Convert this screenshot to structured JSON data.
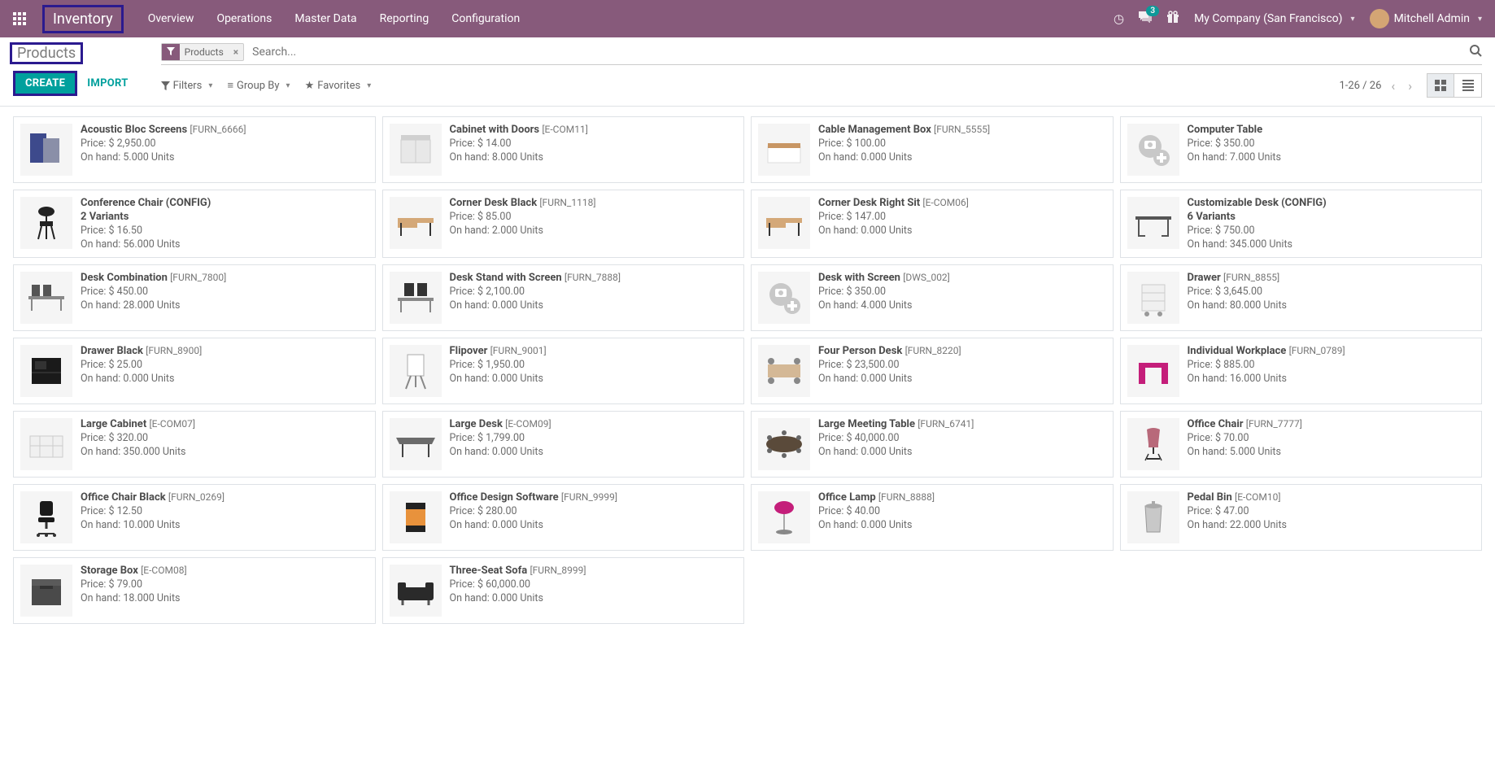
{
  "navbar": {
    "brand": "Inventory",
    "menu": [
      "Overview",
      "Operations",
      "Master Data",
      "Reporting",
      "Configuration"
    ],
    "chat_count": "3",
    "company": "My Company (San Francisco)",
    "user": "Mitchell Admin"
  },
  "breadcrumb": "Products",
  "buttons": {
    "create": "CREATE",
    "import": "IMPORT"
  },
  "search": {
    "facet_label": "Products",
    "placeholder": "Search...",
    "filters": "Filters",
    "groupby": "Group By",
    "favorites": "Favorites"
  },
  "pager": "1-26 / 26",
  "products": [
    {
      "name": "Acoustic Bloc Screens",
      "sku": "[FURN_6666]",
      "price": "Price: $ 2,950.00",
      "onhand": "On hand: 5.000 Units",
      "icon": "screens"
    },
    {
      "name": "Cabinet with Doors",
      "sku": "[E-COM11]",
      "price": "Price: $ 14.00",
      "onhand": "On hand: 8.000 Units",
      "icon": "cabinet"
    },
    {
      "name": "Cable Management Box",
      "sku": "[FURN_5555]",
      "price": "Price: $ 100.00",
      "onhand": "On hand: 0.000 Units",
      "icon": "box-wood"
    },
    {
      "name": "Computer Table",
      "sku": "",
      "price": "Price: $ 350.00",
      "onhand": "On hand: 7.000 Units",
      "icon": "noimg"
    },
    {
      "name": "Conference Chair (CONFIG)",
      "sku": "",
      "variants": "2 Variants",
      "price": "Price: $ 16.50",
      "onhand": "On hand: 56.000 Units",
      "icon": "chair-black"
    },
    {
      "name": "Corner Desk Black",
      "sku": "[FURN_1118]",
      "price": "Price: $ 85.00",
      "onhand": "On hand: 2.000 Units",
      "icon": "desk-corner"
    },
    {
      "name": "Corner Desk Right Sit",
      "sku": "[E-COM06]",
      "price": "Price: $ 147.00",
      "onhand": "On hand: 0.000 Units",
      "icon": "desk-corner"
    },
    {
      "name": "Customizable Desk (CONFIG)",
      "sku": "",
      "variants": "6 Variants",
      "price": "Price: $ 750.00",
      "onhand": "On hand: 345.000 Units",
      "icon": "desk-wire"
    },
    {
      "name": "Desk Combination",
      "sku": "[FURN_7800]",
      "price": "Price: $ 450.00",
      "onhand": "On hand: 28.000 Units",
      "icon": "desk-combo"
    },
    {
      "name": "Desk Stand with Screen",
      "sku": "[FURN_7888]",
      "price": "Price: $ 2,100.00",
      "onhand": "On hand: 0.000 Units",
      "icon": "desk-screen"
    },
    {
      "name": "Desk with Screen",
      "sku": "[DWS_002]",
      "price": "Price: $ 350.00",
      "onhand": "On hand: 4.000 Units",
      "icon": "noimg"
    },
    {
      "name": "Drawer",
      "sku": "[FURN_8855]",
      "price": "Price: $ 3,645.00",
      "onhand": "On hand: 80.000 Units",
      "icon": "drawer-white"
    },
    {
      "name": "Drawer Black",
      "sku": "[FURN_8900]",
      "price": "Price: $ 25.00",
      "onhand": "On hand: 0.000 Units",
      "icon": "drawer-black"
    },
    {
      "name": "Flipover",
      "sku": "[FURN_9001]",
      "price": "Price: $ 1,950.00",
      "onhand": "On hand: 0.000 Units",
      "icon": "flipover"
    },
    {
      "name": "Four Person Desk",
      "sku": "[FURN_8220]",
      "price": "Price: $ 23,500.00",
      "onhand": "On hand: 0.000 Units",
      "icon": "four-desk"
    },
    {
      "name": "Individual Workplace",
      "sku": "[FURN_0789]",
      "price": "Price: $ 885.00",
      "onhand": "On hand: 16.000 Units",
      "icon": "workplace-pink"
    },
    {
      "name": "Large Cabinet",
      "sku": "[E-COM07]",
      "price": "Price: $ 320.00",
      "onhand": "On hand: 350.000 Units",
      "icon": "cabinet-large"
    },
    {
      "name": "Large Desk",
      "sku": "[E-COM09]",
      "price": "Price: $ 1,799.00",
      "onhand": "On hand: 0.000 Units",
      "icon": "desk-large"
    },
    {
      "name": "Large Meeting Table",
      "sku": "[FURN_6741]",
      "price": "Price: $ 40,000.00",
      "onhand": "On hand: 0.000 Units",
      "icon": "meeting"
    },
    {
      "name": "Office Chair",
      "sku": "[FURN_7777]",
      "price": "Price: $ 70.00",
      "onhand": "On hand: 5.000 Units",
      "icon": "chair-pink"
    },
    {
      "name": "Office Chair Black",
      "sku": "[FURN_0269]",
      "price": "Price: $ 12.50",
      "onhand": "On hand: 10.000 Units",
      "icon": "office-chair"
    },
    {
      "name": "Office Design Software",
      "sku": "[FURN_9999]",
      "price": "Price: $ 280.00",
      "onhand": "On hand: 0.000 Units",
      "icon": "software"
    },
    {
      "name": "Office Lamp",
      "sku": "[FURN_8888]",
      "price": "Price: $ 40.00",
      "onhand": "On hand: 0.000 Units",
      "icon": "lamp"
    },
    {
      "name": "Pedal Bin",
      "sku": "[E-COM10]",
      "price": "Price: $ 47.00",
      "onhand": "On hand: 22.000 Units",
      "icon": "bin"
    },
    {
      "name": "Storage Box",
      "sku": "[E-COM08]",
      "price": "Price: $ 79.00",
      "onhand": "On hand: 18.000 Units",
      "icon": "storage"
    },
    {
      "name": "Three-Seat Sofa",
      "sku": "[FURN_8999]",
      "price": "Price: $ 60,000.00",
      "onhand": "On hand: 0.000 Units",
      "icon": "sofa"
    }
  ]
}
